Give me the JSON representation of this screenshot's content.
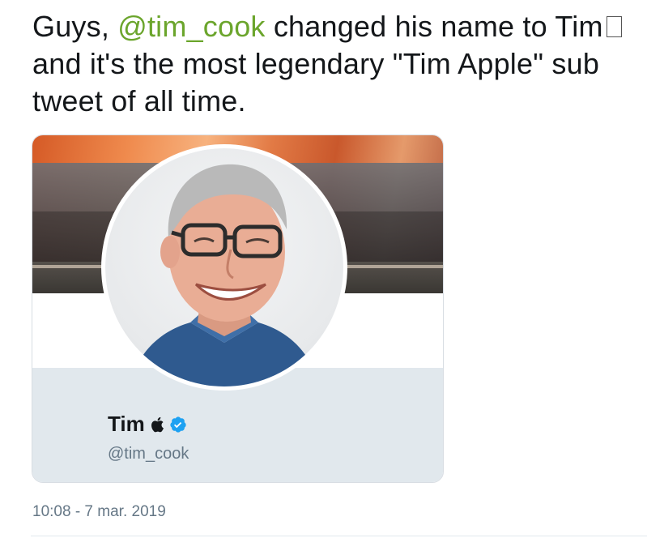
{
  "tweet": {
    "text_before_mention": "Guys, ",
    "mention": "@tim_cook",
    "text_after_mention": " changed his name to Tim",
    "unsupported_glyph": "",
    "text_after_glyph": "and it's the most legendary \"Tim Apple\" sub tweet of all time.",
    "timestamp": "10:08 - 7 mar. 2019"
  },
  "profile_card": {
    "display_name": "Tim",
    "apple_icon": "apple-logo-icon",
    "verified_icon": "verified-badge-icon",
    "handle": "@tim_cook"
  },
  "colors": {
    "mention": "#6ba52c",
    "text": "#14171a",
    "muted": "#657786",
    "verified": "#1da1f2",
    "card_footer": "#e1e8ed"
  }
}
